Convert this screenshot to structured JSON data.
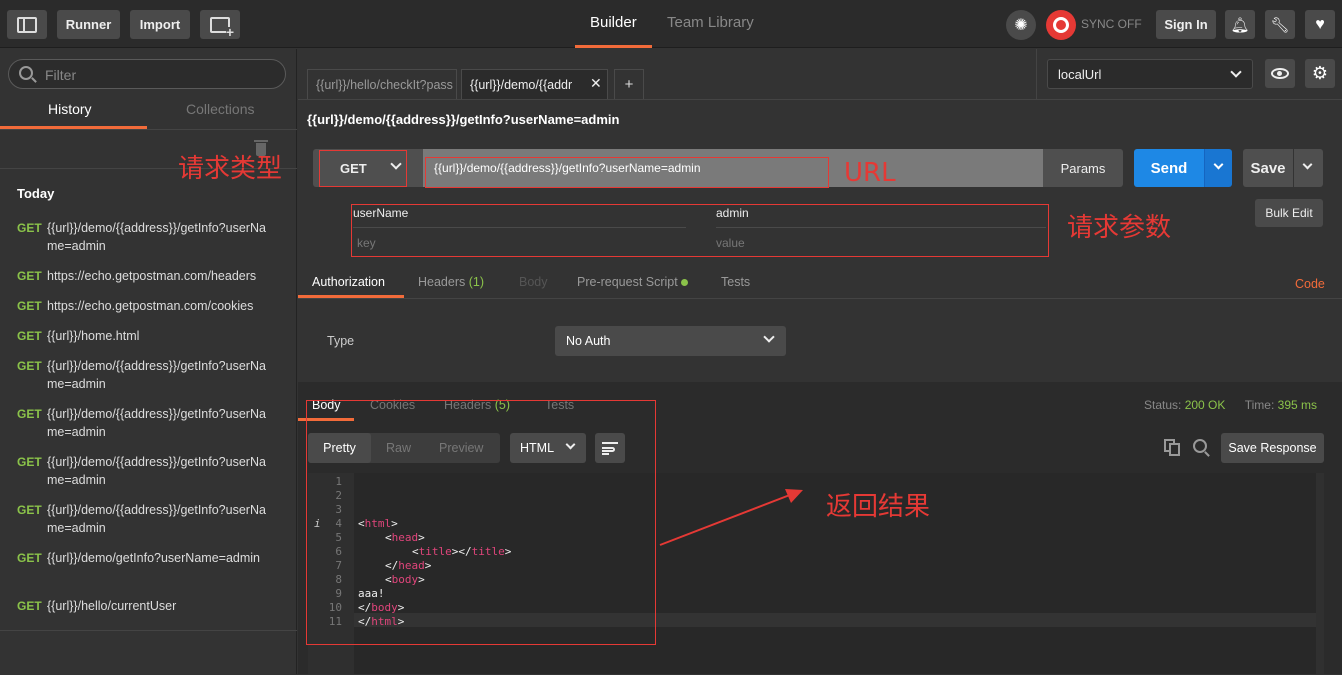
{
  "topbar": {
    "runner": "Runner",
    "import": "Import",
    "builder": "Builder",
    "team_library": "Team Library",
    "sync": "SYNC OFF",
    "sign_in": "Sign In"
  },
  "sidebar": {
    "filter_placeholder": "Filter",
    "tab_history": "History",
    "tab_collections": "Collections",
    "section": "Today",
    "items": [
      {
        "method": "GET",
        "url": "{{url}}/demo/{{address}}/getInfo?userName=admin"
      },
      {
        "method": "GET",
        "url": "https://echo.getpostman.com/headers"
      },
      {
        "method": "GET",
        "url": "https://echo.getpostman.com/cookies"
      },
      {
        "method": "GET",
        "url": "{{url}}/home.html"
      },
      {
        "method": "GET",
        "url": "{{url}}/demo/{{address}}/getInfo?userName=admin"
      },
      {
        "method": "GET",
        "url": "{{url}}/demo/{{address}}/getInfo?userName=admin"
      },
      {
        "method": "GET",
        "url": "{{url}}/demo/{{address}}/getInfo?userName=admin"
      },
      {
        "method": "GET",
        "url": "{{url}}/demo/{{address}}/getInfo?userName=admin"
      },
      {
        "method": "GET",
        "url": "{{url}}/demo/getInfo?userName=admin"
      },
      {
        "method": "GET",
        "url": "{{url}}/hello/currentUser"
      }
    ]
  },
  "tabs": {
    "tab1": "{{url}}/hello/checkIt?pass",
    "tab2": "{{url}}/demo/{{addr",
    "add": "+"
  },
  "env": {
    "selected": "localUrl"
  },
  "request": {
    "title": "{{url}}/demo/{{address}}/getInfo?userName=admin",
    "method": "GET",
    "url": "{{url}}/demo/{{address}}/getInfo?userName=admin",
    "params_btn": "Params",
    "send": "Send",
    "save": "Save",
    "bulk_edit": "Bulk Edit",
    "param_key": "userName",
    "param_value": "admin",
    "key_placeholder": "key",
    "value_placeholder": "value"
  },
  "annotations": {
    "type": "请求类型",
    "url": "URL",
    "params": "请求参数",
    "result": "返回结果"
  },
  "reqtabs": {
    "authorization": "Authorization",
    "headers": "Headers",
    "headers_count": "(1)",
    "body": "Body",
    "prerequest": "Pre-request Script",
    "tests": "Tests",
    "code": "Code"
  },
  "auth": {
    "type_label": "Type",
    "type_value": "No Auth"
  },
  "response": {
    "tab_body": "Body",
    "tab_cookies": "Cookies",
    "tab_headers": "Headers",
    "headers_count": "(5)",
    "tab_tests": "Tests",
    "status_label": "Status:",
    "status_value": "200 OK",
    "time_label": "Time:",
    "time_value": "395 ms",
    "pretty": "Pretty",
    "raw": "Raw",
    "preview": "Preview",
    "format": "HTML",
    "save_response": "Save Response"
  },
  "code_lines": [
    "1",
    "2",
    "3",
    "4",
    "5",
    "6",
    "7",
    "8",
    "9",
    "10",
    "11"
  ],
  "code_text": {
    "l4_open": "<",
    "l4_tag": "html",
    "l4_close": ">",
    "l5_tag": "head",
    "l6_tag1": "title",
    "l6_tag2": "title",
    "l7_tag": "head",
    "l8_tag": "body",
    "l9": "aaa!",
    "l10_tag": "body",
    "l11_tag": "html"
  },
  "colors": {
    "accent": "#f26b3a",
    "send": "#1e88e5",
    "annotation": "#e53935",
    "method": "#8bc34a"
  }
}
